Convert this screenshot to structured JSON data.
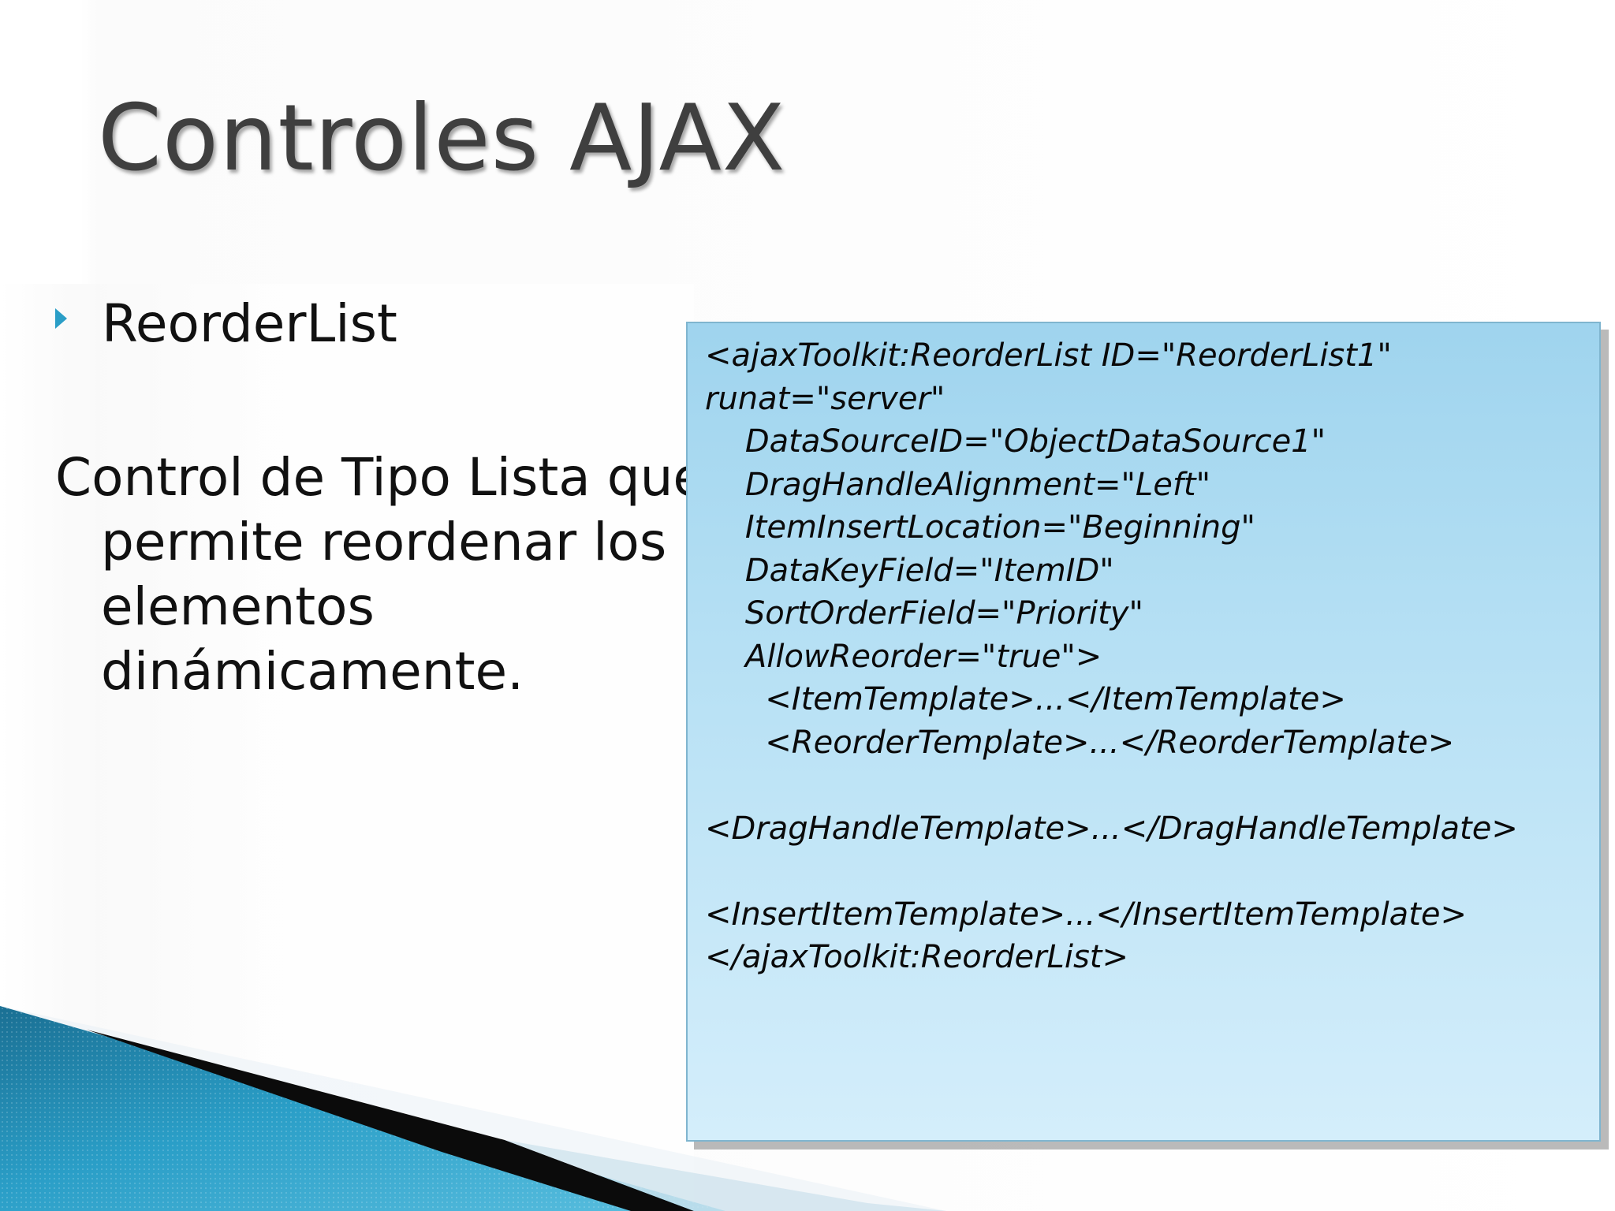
{
  "slide": {
    "title": "Controles AJAX",
    "bullet": "ReorderList",
    "paragraph": "Control de Tipo Lista que permite reordenar los elementos dinámicamente.",
    "paragraph_lines": [
      "Control de Tipo Lista que",
      "permite reordenar los",
      "elementos",
      "dinámicamente."
    ]
  },
  "code_box": {
    "lines": [
      "<ajaxToolkit:ReorderList ID=\"ReorderList1\"",
      "runat=\"server\"",
      "    DataSourceID=\"ObjectDataSource1\"",
      "    DragHandleAlignment=\"Left\"",
      "    ItemInsertLocation=\"Beginning\"",
      "    DataKeyField=\"ItemID\"",
      "    SortOrderField=\"Priority\"",
      "    AllowReorder=\"true\">",
      "      <ItemTemplate>...</ItemTemplate>",
      "      <ReorderTemplate>...</ReorderTemplate>",
      "",
      "<DragHandleTemplate>...</DragHandleTemplate>",
      "",
      "<InsertItemTemplate>...</InsertItemTemplate>",
      "</ajaxToolkit:ReorderList>"
    ]
  },
  "colors": {
    "bullet_accent": "#2a9ec7",
    "code_box_top": "#9fd4ee",
    "code_box_bottom": "#d4eefb",
    "decor_blue": "#1f8fbf"
  }
}
